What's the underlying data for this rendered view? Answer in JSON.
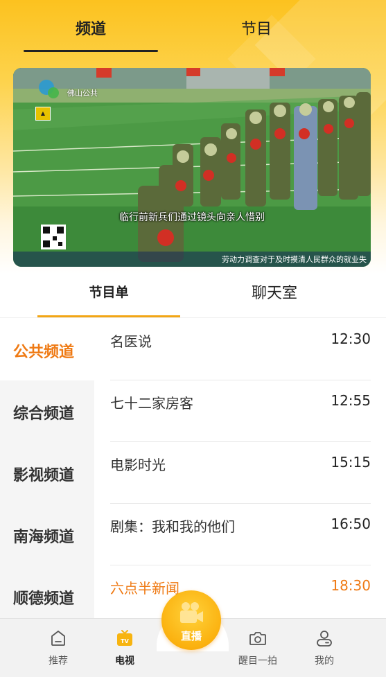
{
  "header": {
    "tabs": [
      {
        "label": "频道",
        "active": true
      },
      {
        "label": "节目",
        "active": false
      }
    ]
  },
  "video": {
    "station_logo_text": "佛山公共",
    "caption": "临行前新兵们通过镜头向亲人惜别",
    "ticker": "劳动力调查对于及时摸清人民群众的就业失"
  },
  "sub_tabs": [
    {
      "label": "节目单",
      "active": true
    },
    {
      "label": "聊天室",
      "active": false
    }
  ],
  "channels": [
    {
      "label": "公共频道",
      "active": true
    },
    {
      "label": "综合频道",
      "active": false
    },
    {
      "label": "影视频道",
      "active": false
    },
    {
      "label": "南海频道",
      "active": false
    },
    {
      "label": "顺德频道",
      "active": false
    }
  ],
  "programs": [
    {
      "name": "名医说",
      "time": "12:30",
      "live": false
    },
    {
      "name": "七十二家房客",
      "time": "12:55",
      "live": false
    },
    {
      "name": "电影时光",
      "time": "15:15",
      "live": false
    },
    {
      "name": "剧集：我和我的他们",
      "time": "16:50",
      "live": false
    },
    {
      "name": "六点半新闻",
      "time": "18:30",
      "live": true
    }
  ],
  "bottom_nav": {
    "items": [
      {
        "label": "推荐",
        "icon": "home-icon"
      },
      {
        "label": "电视",
        "icon": "tv-icon",
        "active": true
      },
      {
        "label": "醒目一拍",
        "icon": "camera-icon"
      },
      {
        "label": "我的",
        "icon": "profile-icon"
      }
    ],
    "live_button": {
      "label": "直播",
      "icon": "video-camera-icon"
    }
  },
  "colors": {
    "accent": "#ef7a14",
    "header_yellow": "#fcc21f",
    "indicator": "#f3a615"
  }
}
